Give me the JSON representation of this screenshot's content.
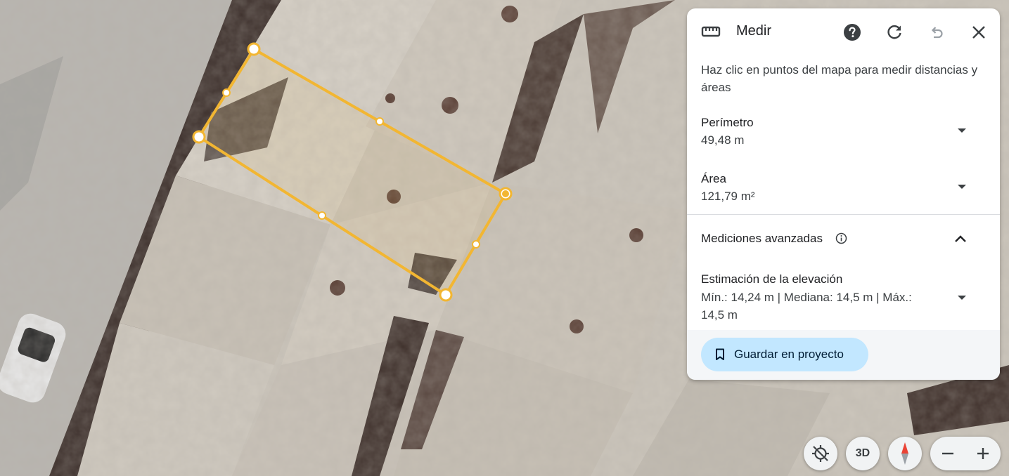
{
  "panel": {
    "title": "Medir",
    "instructions": "Haz clic en puntos del mapa para medir distancias y áreas",
    "perimeter": {
      "label": "Perímetro",
      "value": "49,48 m"
    },
    "area": {
      "label": "Área",
      "value": "121,79 m²"
    },
    "advanced": {
      "label": "Mediciones avanzadas"
    },
    "elevation": {
      "label": "Estimación de la elevación",
      "value": "Mín.: 14,24 m | Mediana: 14,5 m | Máx.: 14,5 m"
    },
    "save_label": "Guardar en proyecto"
  },
  "controls": {
    "three_d_label": "3D"
  },
  "colors": {
    "measure_line": "#f2b632",
    "save_button_bg": "#c2e7ff",
    "compass_red": "#ea4335"
  },
  "icons": [
    "ruler-icon",
    "help-icon",
    "refresh-icon",
    "undo-icon",
    "close-icon",
    "info-icon",
    "bookmark-icon",
    "location-off-icon",
    "compass-icon",
    "minus-icon",
    "plus-icon"
  ]
}
